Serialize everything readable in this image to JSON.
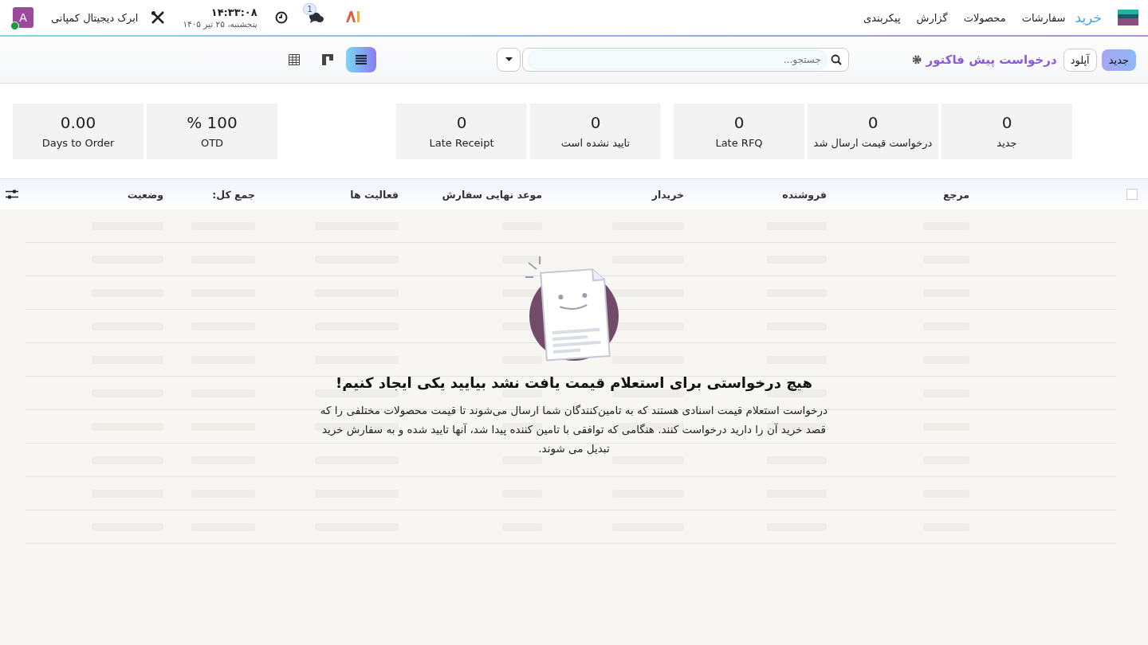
{
  "navbar": {
    "app_name": "خرید",
    "menu": [
      "سفارشات",
      "محصولات",
      "گزارش",
      "پیکربندی"
    ],
    "chat_badge": "1",
    "clock_time": "۱۴:۳۳:۰۸",
    "clock_date": "پنجشنبه، ۲۵ تیر ۱۴۰۵",
    "company": "ابرک دیجیتال کمپانی",
    "avatar_letter": "A"
  },
  "control_panel": {
    "new_button": "جدید",
    "upload_button": "آپلود",
    "title": "درخواست پیش فاکتور",
    "search": {
      "placeholder": "جستجو..."
    },
    "views": [
      {
        "kind": "list",
        "selected": true
      },
      {
        "kind": "kanban",
        "selected": false
      },
      {
        "kind": "pivot",
        "selected": false
      }
    ]
  },
  "stat_groups": [
    [
      {
        "value": "0",
        "label": "جدید"
      },
      {
        "value": "0",
        "label": "درخواست قیمت ارسال شد"
      },
      {
        "value": "0",
        "label": "Late RFQ"
      }
    ],
    [
      {
        "value": "0",
        "label": "تایید نشده است"
      },
      {
        "value": "0",
        "label": "Late Receipt"
      }
    ],
    [
      {
        "value": "100 %",
        "label": "OTD"
      },
      {
        "value": "0.00",
        "label": "Days to Order"
      }
    ]
  ],
  "table": {
    "select_all_checked": false,
    "columns": [
      "مرجع",
      "فروشنده",
      "خریدار",
      "موعد نهایی سفارش",
      "فعالیت ها",
      "جمع کل:",
      "وضعیت"
    ]
  },
  "empty_state": {
    "title": "هیچ درخواستی برای استعلام قیمت یافت نشد بیایید یکی ایجاد کنیم!",
    "text": "درخواست استعلام قیمت اسنادی هستند که به تامین‌کنندگان شما ارسال می‌شوند تا قیمت محصولات مختلفی را که قصد خرید آن را دارید درخواست کنند. هنگامی که توافقی با تامین کننده پیدا شد، آنها تایید شده و به سفارش خرید تبدیل می شوند."
  }
}
